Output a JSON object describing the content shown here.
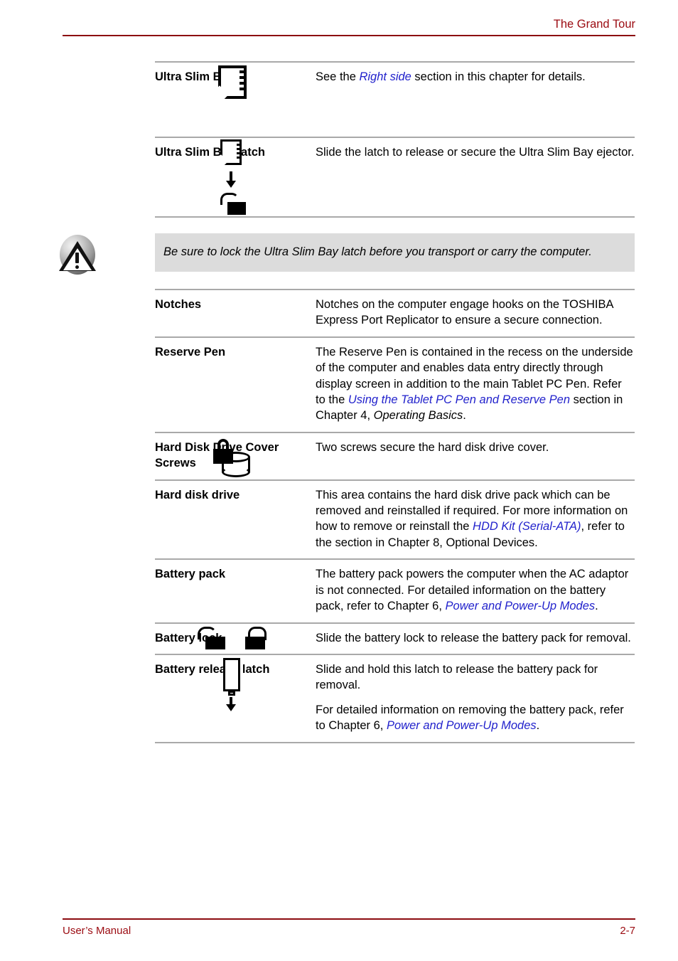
{
  "header": {
    "chapter_title": "The Grand Tour"
  },
  "footer": {
    "manual_label": "User’s Manual",
    "page_number": "2-7"
  },
  "caution": {
    "icon": "warning-triangle-icon",
    "text": "Be sure to lock the Ultra Slim Bay latch before you transport or carry the computer."
  },
  "table": {
    "rows": [
      {
        "id": "ultra-slim-bay",
        "icon": "ultra-slim-bay-icon",
        "term": "Ultra Slim Bay",
        "desc_runs": [
          {
            "t": "See the ",
            "s": "plain"
          },
          {
            "t": "Right side",
            "s": "link"
          },
          {
            "t": " section in this chapter for details.",
            "s": "plain"
          }
        ]
      },
      {
        "id": "ultra-slim-bay-latch",
        "icon": "ultra-slim-bay-latch-icon",
        "term": "Ultra Slim Bay latch",
        "desc_runs": [
          {
            "t": "Slide the latch to release or secure the Ultra Slim Bay ejector.",
            "s": "plain"
          }
        ]
      },
      {
        "id": "notches",
        "icon": "",
        "term": "Notches",
        "desc_runs": [
          {
            "t": "Notches on the computer engage hooks on the TOSHIBA Express Port Replicator to ensure a secure connection.",
            "s": "plain"
          }
        ]
      },
      {
        "id": "reserve-pen",
        "icon": "",
        "term": "Reserve Pen",
        "desc_runs": [
          {
            "t": "The Reserve Pen is contained in the recess on the underside of the computer and enables data entry directly through display screen in addition to the main Tablet PC Pen. Refer to the ",
            "s": "plain"
          },
          {
            "t": "Using the Tablet PC Pen and Reserve Pen",
            "s": "link"
          },
          {
            "t": " section in Chapter 4, ",
            "s": "plain"
          },
          {
            "t": "Operating Basics",
            "s": "italic"
          },
          {
            "t": ".",
            "s": "plain"
          }
        ]
      },
      {
        "id": "hard-disk-drive-cover-screws",
        "icon": "hdd-lock-icon",
        "term": "Hard Disk Drive Cover Screws",
        "desc_runs": [
          {
            "t": "Two screws secure the hard disk drive cover.",
            "s": "plain"
          }
        ]
      },
      {
        "id": "hard-disk-drive",
        "icon": "",
        "term": "Hard disk drive",
        "desc_runs": [
          {
            "t": "This area contains the hard disk drive pack which can be removed and reinstalled if required. For more information on how to remove or reinstall the ",
            "s": "plain"
          },
          {
            "t": "HDD Kit (Serial-ATA)",
            "s": "link"
          },
          {
            "t": ", refer to the section in Chapter 8, Optional Devices.",
            "s": "plain"
          }
        ]
      },
      {
        "id": "battery-pack",
        "icon": "",
        "term": "Battery pack",
        "desc_runs": [
          {
            "t": "The battery pack powers the computer when the AC adaptor is not connected. For detailed information on the battery pack, refer to Chapter 6, ",
            "s": "plain"
          },
          {
            "t": "Power and Power-Up Modes",
            "s": "link"
          },
          {
            "t": ".",
            "s": "plain"
          }
        ]
      },
      {
        "id": "battery-lock",
        "icon": "battery-lock-icons",
        "term": "Battery lock",
        "desc_runs": [
          {
            "t": "Slide the battery lock to release the battery pack for removal.",
            "s": "plain"
          }
        ]
      },
      {
        "id": "battery-release-latch",
        "icon": "battery-release-latch-icon",
        "term": "Battery release latch",
        "desc_runs": [
          {
            "t": "Slide and hold this latch to release the battery pack for removal.",
            "s": "plain"
          }
        ],
        "desc_runs2": [
          {
            "t": "For detailed information on removing the battery pack, refer to Chapter 6, ",
            "s": "plain"
          },
          {
            "t": "Power and Power-Up Modes",
            "s": "link"
          },
          {
            "t": ".",
            "s": "plain"
          }
        ]
      }
    ]
  },
  "colors": {
    "accent_red": "#9B0B11",
    "link_blue": "#2222CC",
    "rule_grey": "#A9A9A9",
    "caution_bg": "#DCDCDC"
  }
}
